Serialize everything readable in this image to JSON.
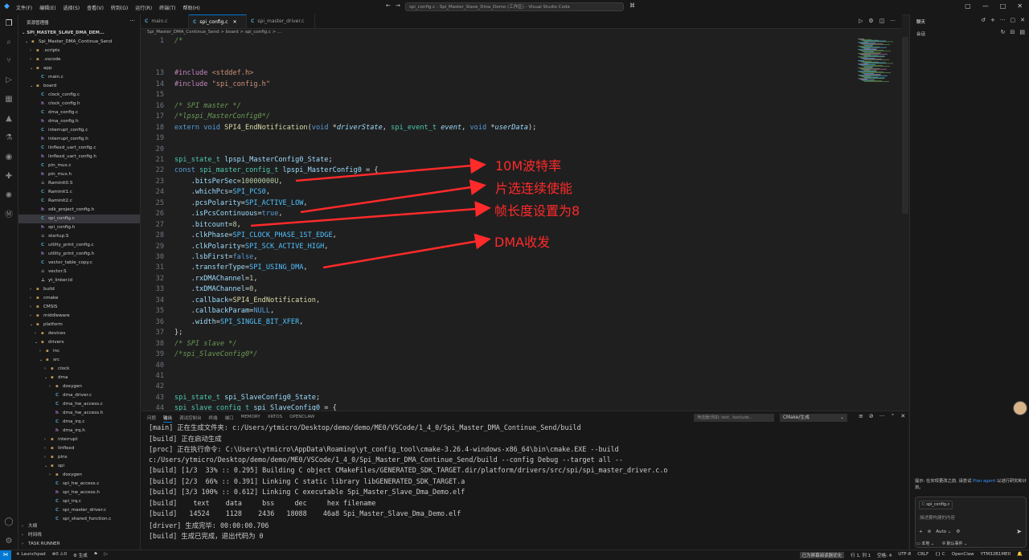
{
  "window": {
    "menu": [
      "文件(F)",
      "编辑(E)",
      "选择(S)",
      "查看(V)",
      "转到(G)",
      "运行(R)",
      "终端(T)",
      "帮助(H)"
    ],
    "search_text": "spi_config.c - Spi_Master_Slave_Dma_Demo (工作区) - Visual Studio Code"
  },
  "sidebar": {
    "title": "资源管理器",
    "workspace": "SPI_MASTER_SLAVE_DMA_DEM...",
    "tree": [
      {
        "label": "Spi_Master_DMA_Continue_Send",
        "depth": 1,
        "kind": "folder",
        "open": true
      },
      {
        "label": ".scripts",
        "depth": 2,
        "kind": "folder",
        "open": false
      },
      {
        "label": ".vscode",
        "depth": 2,
        "kind": "folder",
        "open": false
      },
      {
        "label": "app",
        "depth": 2,
        "kind": "folder",
        "open": true
      },
      {
        "label": "main.c",
        "depth": 3,
        "kind": "c"
      },
      {
        "label": "board",
        "depth": 2,
        "kind": "folder",
        "open": true
      },
      {
        "label": "clock_config.c",
        "depth": 3,
        "kind": "c"
      },
      {
        "label": "clock_config.h",
        "depth": 3,
        "kind": "h"
      },
      {
        "label": "dma_config.c",
        "depth": 3,
        "kind": "c"
      },
      {
        "label": "dma_config.h",
        "depth": 3,
        "kind": "h"
      },
      {
        "label": "interrupt_config.c",
        "depth": 3,
        "kind": "c"
      },
      {
        "label": "interrupt_config.h",
        "depth": 3,
        "kind": "h"
      },
      {
        "label": "linflexd_uart_config.c",
        "depth": 3,
        "kind": "c"
      },
      {
        "label": "linflexd_uart_config.h",
        "depth": 3,
        "kind": "h"
      },
      {
        "label": "pin_mux.c",
        "depth": 3,
        "kind": "c"
      },
      {
        "label": "pin_mux.h",
        "depth": 3,
        "kind": "h"
      },
      {
        "label": "Raminit0.S",
        "depth": 3,
        "kind": "s"
      },
      {
        "label": "Raminit1.c",
        "depth": 3,
        "kind": "c"
      },
      {
        "label": "Raminit2.c",
        "depth": 3,
        "kind": "c"
      },
      {
        "label": "sdk_project_config.h",
        "depth": 3,
        "kind": "h"
      },
      {
        "label": "spi_config.c",
        "depth": 3,
        "kind": "c",
        "selected": true
      },
      {
        "label": "spi_config.h",
        "depth": 3,
        "kind": "h"
      },
      {
        "label": "startup.S",
        "depth": 3,
        "kind": "s"
      },
      {
        "label": "utility_print_config.c",
        "depth": 3,
        "kind": "c"
      },
      {
        "label": "utility_print_config.h",
        "depth": 3,
        "kind": "h"
      },
      {
        "label": "vector_table_copy.c",
        "depth": 3,
        "kind": "c"
      },
      {
        "label": "vector.S",
        "depth": 3,
        "kind": "s"
      },
      {
        "label": "yt_linker.ld",
        "depth": 3,
        "kind": "ld"
      },
      {
        "label": "build",
        "depth": 2,
        "kind": "folder",
        "open": false
      },
      {
        "label": "cmake",
        "depth": 2,
        "kind": "folder",
        "open": false
      },
      {
        "label": "CMSIS",
        "depth": 2,
        "kind": "folder",
        "open": false
      },
      {
        "label": "middleware",
        "depth": 2,
        "kind": "folder",
        "open": false
      },
      {
        "label": "platform",
        "depth": 2,
        "kind": "folder",
        "open": true
      },
      {
        "label": "devices",
        "depth": 3,
        "kind": "folder",
        "open": false
      },
      {
        "label": "drivers",
        "depth": 3,
        "kind": "folder",
        "open": true
      },
      {
        "label": "inc",
        "depth": 4,
        "kind": "folder",
        "open": false
      },
      {
        "label": "src",
        "depth": 4,
        "kind": "folder",
        "open": true
      },
      {
        "label": "clock",
        "depth": 5,
        "kind": "folder",
        "open": false
      },
      {
        "label": "dma",
        "depth": 5,
        "kind": "folder",
        "open": true
      },
      {
        "label": "doxygen",
        "depth": 6,
        "kind": "folder",
        "open": false
      },
      {
        "label": "dma_driver.c",
        "depth": 6,
        "kind": "c"
      },
      {
        "label": "dma_hw_access.c",
        "depth": 6,
        "kind": "c"
      },
      {
        "label": "dma_hw_access.h",
        "depth": 6,
        "kind": "h"
      },
      {
        "label": "dma_irq.c",
        "depth": 6,
        "kind": "c"
      },
      {
        "label": "dma_irq.h",
        "depth": 6,
        "kind": "h"
      },
      {
        "label": "interrupt",
        "depth": 5,
        "kind": "folder",
        "open": false
      },
      {
        "label": "linflexd",
        "depth": 5,
        "kind": "folder",
        "open": false
      },
      {
        "label": "pins",
        "depth": 5,
        "kind": "folder",
        "open": false
      },
      {
        "label": "spi",
        "depth": 5,
        "kind": "folder",
        "open": true
      },
      {
        "label": "doxygen",
        "depth": 6,
        "kind": "folder",
        "open": false
      },
      {
        "label": "spi_hw_access.c",
        "depth": 6,
        "kind": "c"
      },
      {
        "label": "spi_hw_access.h",
        "depth": 6,
        "kind": "h"
      },
      {
        "label": "spi_irq.c",
        "depth": 6,
        "kind": "c"
      },
      {
        "label": "spi_master_driver.c",
        "depth": 6,
        "kind": "c"
      },
      {
        "label": "spi_shared_function.c",
        "depth": 6,
        "kind": "c"
      }
    ],
    "bottom_sections": [
      "大纲",
      "时间线",
      "TASK RUNNER"
    ]
  },
  "tabs": [
    {
      "label": "main.c",
      "active": false
    },
    {
      "label": "spi_config.c",
      "active": true
    },
    {
      "label": "spi_master_driver.c",
      "active": false
    }
  ],
  "breadcrumb": "Spi_Master_DMA_Continue_Send > board > spi_config.c > ...",
  "editor": {
    "line_numbers": [
      "1",
      "",
      "",
      "13",
      "14",
      "15",
      "16",
      "17",
      "18",
      "19",
      "20",
      "21",
      "22",
      "23",
      "24",
      "25",
      "26",
      "27",
      "28",
      "29",
      "30",
      "31",
      "32",
      "33",
      "34",
      "35",
      "36",
      "37",
      "38",
      "39",
      "40",
      "41",
      "42",
      "43",
      "44"
    ],
    "lines": [
      "/*",
      "",
      "",
      "#include <stddef.h>",
      "#include \"spi_config.h\"",
      "",
      "/* SPI master */",
      "/*lpspi_MasterConfig0*/",
      "extern void SPI4_EndNotification(void *driverState, spi_event_t event, void *userData);",
      "",
      "",
      "spi_state_t lpspi_MasterConfig0_State;",
      "const spi_master_config_t lpspi_MasterConfig0 = {",
      "    .bitsPerSec=10000000U,",
      "    .whichPcs=SPI_PCS0,",
      "    .pcsPolarity=SPI_ACTIVE_LOW,",
      "    .isPcsContinuous=true,",
      "    .bitcount=8,",
      "    .clkPhase=SPI_CLOCK_PHASE_1ST_EDGE,",
      "    .clkPolarity=SPI_SCK_ACTIVE_HIGH,",
      "    .lsbFirst=false,",
      "    .transferType=SPI_USING_DMA,",
      "    .rxDMAChannel=1,",
      "    .txDMAChannel=0,",
      "    .callback=SPI4_EndNotification,",
      "    .callbackParam=NULL,",
      "    .width=SPI_SINGLE_BIT_XFER,",
      "};",
      "/* SPI slave */",
      "/*spi_SlaveConfig0*/",
      "",
      "",
      "",
      "spi_state_t spi_SlaveConfig0_State;",
      "spi_slave_config_t spi_SlaveConfig0 = {"
    ]
  },
  "annotations": [
    {
      "text": "10M波特率"
    },
    {
      "text": "片选连续使能"
    },
    {
      "text": "帧长度设置为8"
    },
    {
      "text": "DMA收发"
    }
  ],
  "panel": {
    "tabs": [
      "问题",
      "输出",
      "调试控制台",
      "终端",
      "端口",
      "MEMORY",
      "XRTOS",
      "OPENCLAW"
    ],
    "active_tab": "输出",
    "filter_placeholder": "筛选器(例如: text, !exclude...",
    "channel": "CMake/生成",
    "output": [
      "[main] 正在生成文件夹: c:/Users/ytmicro/Desktop/demo/demo/ME0/VSCode/1_4_0/Spi_Master_DMA_Continue_Send/build",
      "[build] 正在启动生成",
      "[proc] 正在执行命令: C:\\Users\\ytmicro\\AppData\\Roaming\\yt_config_tool\\cmake-3.26.4-windows-x86_64\\bin\\cmake.EXE --build",
      "c:/Users/ytmicro/Desktop/demo/demo/ME0/VSCode/1_4_0/Spi_Master_DMA_Continue_Send/build --config Debug --target all --",
      "[build] [1/3  33% :: 0.295] Building C object CMakeFiles/GENERATED_SDK_TARGET.dir/platform/drivers/src/spi/spi_master_driver.c.o",
      "[build] [2/3  66% :: 0.391] Linking C static library libGENERATED_SDK_TARGET.a",
      "[build] [3/3 100% :: 0.612] Linking C executable Spi_Master_Slave_Dma_Demo.elf",
      "[build]    text    data     bss     dec     hex filename",
      "[build]   14524    1128    2436   18088    46a8 Spi_Master_Slave_Dma_Demo.elf",
      "[driver] 生成完毕: 00:00:00.706",
      "[build] 生成已完成，退出代码为 0"
    ]
  },
  "chat": {
    "title": "聊天",
    "subtitle": "会话",
    "hint_prefix": "提示: 在实现更改之前, 请尝试 ",
    "hint_link": "Plan agent",
    "hint_suffix": " 以进行研究和计划。",
    "context_chip": "spi_config.c",
    "input_placeholder": "描述要构建的内容",
    "model": "Auto",
    "footer_left": "本地",
    "footer_right": "默认事件"
  },
  "statusbar": {
    "launch": "Launchpad",
    "errors": "0",
    "warnings": "0",
    "build": "生成",
    "notice": "已为屏幕阅读器优化",
    "position": "行 1, 列 1",
    "spaces": "空格: 4",
    "encoding": "UTF-8",
    "eol": "CRLF",
    "lang": "C",
    "openclaw": "OpenClaw",
    "chip": "YTM32B1ME0"
  },
  "colors": {
    "accent": "#0078d4",
    "annotation": "#ff2a2a",
    "bg": "#1f1f1f",
    "chrome": "#181818"
  }
}
